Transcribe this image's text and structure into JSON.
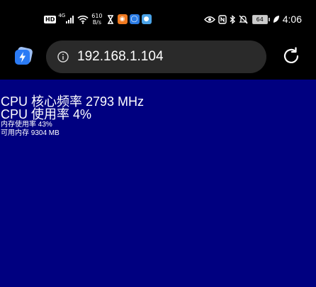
{
  "status_bar": {
    "hd_badge": "HD",
    "net_type": "4G",
    "speed_value": "610",
    "speed_unit": "B/s",
    "battery_level": "64",
    "time": "4:06",
    "icons": [
      "hourglass-icon",
      "orange-app-icon",
      "blue-app-icon",
      "globe-app-icon",
      "eye-icon",
      "nfc-icon",
      "bluetooth-icon",
      "mute-icon",
      "battery-icon",
      "leaf-icon"
    ]
  },
  "toolbar": {
    "url": "192.168.1.104",
    "accent": "#2b7bf5"
  },
  "page": {
    "background": "#000080",
    "lines": [
      "CPU 核心频率 2793 MHz",
      "CPU 使用率 4%",
      "内存使用率 43%",
      "可用内存 9304 MB"
    ]
  }
}
